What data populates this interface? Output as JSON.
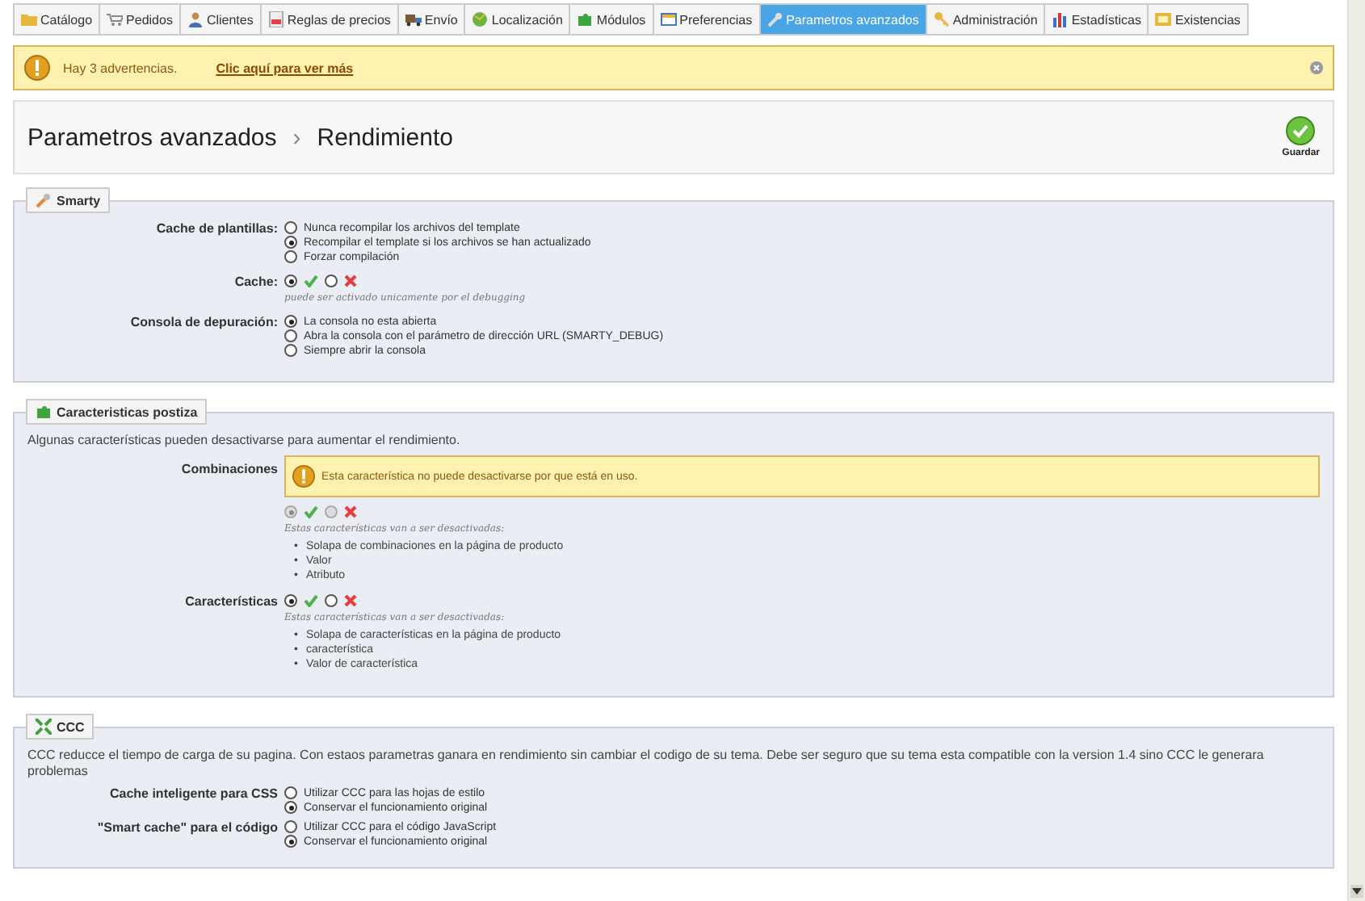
{
  "tabs": [
    {
      "label": "Catálogo",
      "selected": false
    },
    {
      "label": "Pedidos",
      "selected": false
    },
    {
      "label": "Clientes",
      "selected": false
    },
    {
      "label": "Reglas de precios",
      "selected": false
    },
    {
      "label": "Envío",
      "selected": false
    },
    {
      "label": "Localización",
      "selected": false
    },
    {
      "label": "Módulos",
      "selected": false
    },
    {
      "label": "Preferencias",
      "selected": false
    },
    {
      "label": "Parametros avanzados",
      "selected": true
    },
    {
      "label": "Administración",
      "selected": false
    },
    {
      "label": "Estadísticas",
      "selected": false
    },
    {
      "label": "Existencias",
      "selected": false
    }
  ],
  "alert": {
    "text": "Hay 3 advertencias.",
    "link": "Clic aquí para ver más"
  },
  "header": {
    "section": "Parametros avanzados",
    "separator": "›",
    "page": "Rendimiento",
    "save": "Guardar"
  },
  "sections": [
    {
      "title": "Smarty",
      "fields": [
        {
          "kind": "radio",
          "label": "Cache de plantillas:",
          "options": [
            {
              "label": "Nunca recompilar los archivos del template",
              "selected": false
            },
            {
              "label": "Recompilar el template si los archivos se han actualizado",
              "selected": true
            },
            {
              "label": "Forzar compilación",
              "selected": false
            }
          ]
        },
        {
          "kind": "toggle",
          "label": "Cache:",
          "on": true,
          "disabled": false,
          "hint": "puede ser activado unicamente por el debugging"
        },
        {
          "kind": "radio",
          "label": "Consola de depuración:",
          "options": [
            {
              "label": "La consola no esta abierta",
              "selected": true
            },
            {
              "label": "Abra la consola con el parámetro de dirección URL (SMARTY_DEBUG)",
              "selected": false
            },
            {
              "label": "Siempre abrir la consola",
              "selected": false
            }
          ]
        }
      ]
    },
    {
      "title": "Caracteristicas postiza",
      "intro": "Algunas características pueden desactivarse para aumentar el rendimiento.",
      "fields": [
        {
          "kind": "toggle",
          "label": "Combinaciones",
          "on": true,
          "disabled": true,
          "warning": "Esta característica no puede desactivarse por que está en uso.",
          "note": "Estas características van a ser desactivadas:",
          "bullet": "•",
          "items": [
            "Solapa de combinaciones en la página de producto",
            "Valor",
            "Atributo"
          ]
        },
        {
          "kind": "toggle",
          "label": "Características",
          "on": true,
          "disabled": false,
          "note": "Estas características van a ser desactivadas:",
          "bullet": "•",
          "items": [
            "Solapa de características en la página de producto",
            "característica",
            "Valor de característica"
          ]
        }
      ]
    },
    {
      "title": "CCC",
      "intro": "CCC reducce el tiempo de carga de su pagina. Con estaos parametras ganara en rendimiento sin cambiar el codigo de su tema. Debe ser seguro que su tema esta compatible con la version 1.4 sino CCC le generara problemas",
      "fields": [
        {
          "kind": "radio",
          "label": "Cache inteligente para CSS",
          "options": [
            {
              "label": "Utilizar CCC para las hojas de estilo",
              "selected": false
            },
            {
              "label": "Conservar el funcionamiento original",
              "selected": true
            }
          ]
        },
        {
          "kind": "radio",
          "label": "\"Smart cache\" para el código",
          "options": [
            {
              "label": "Utilizar CCC para el código JavaScript",
              "selected": false
            },
            {
              "label": "Conservar el funcionamiento original",
              "selected": true
            }
          ]
        }
      ]
    }
  ]
}
